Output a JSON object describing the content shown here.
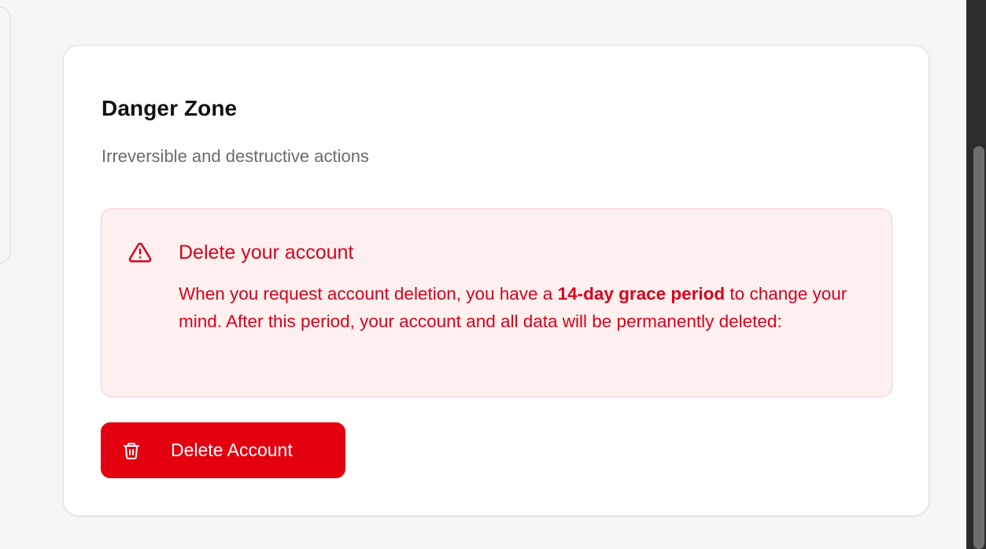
{
  "danger_zone": {
    "title": "Danger Zone",
    "subtitle": "Irreversible and destructive actions",
    "alert": {
      "icon": "warning-triangle-icon",
      "title": "Delete your account",
      "body_before": "When you request account deletion, you have a ",
      "body_emphasis": "14-day grace period",
      "body_after": " to change your mind. After this period, your account and all data will be permanently deleted:"
    },
    "delete_button": {
      "icon": "trash-icon",
      "label": "Delete Account"
    }
  },
  "colors": {
    "danger": "#e3000f",
    "danger_text": "#d9001b",
    "alert_background": "#fff0f0",
    "alert_border": "#f8c9c9"
  }
}
